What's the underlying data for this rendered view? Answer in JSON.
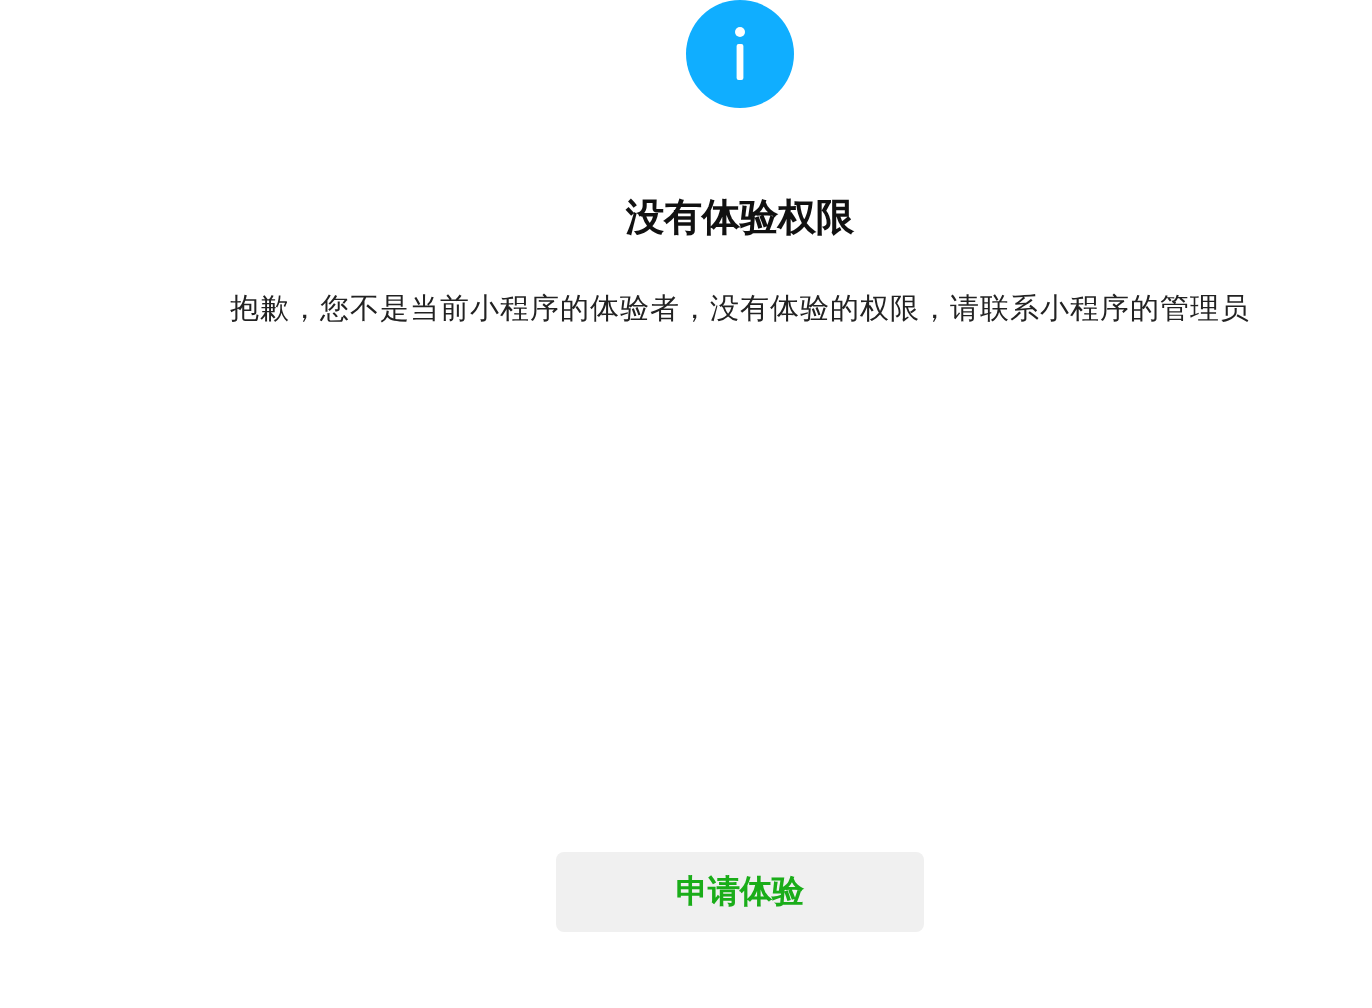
{
  "title": "没有体验权限",
  "message": "抱歉，您不是当前小程序的体验者，没有体验的权限，请联系小程序的管理员",
  "button": "申请体验"
}
